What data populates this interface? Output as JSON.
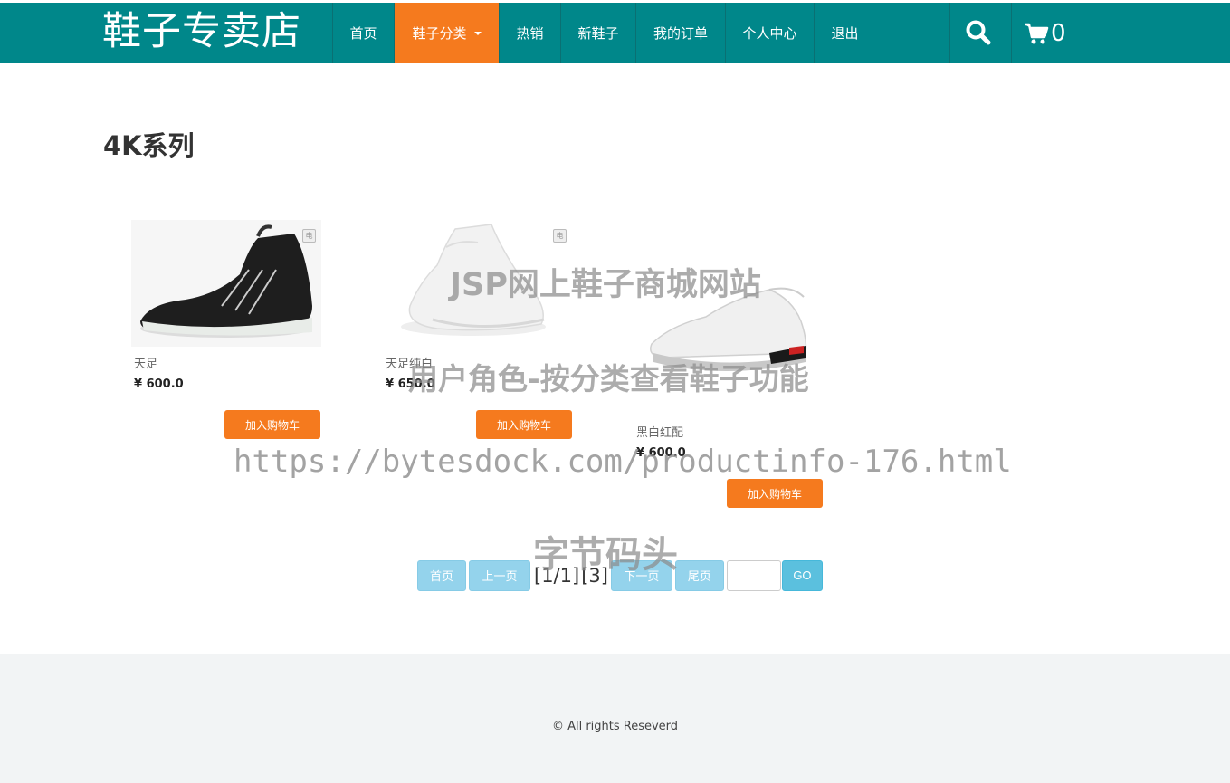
{
  "header": {
    "brand": "鞋子专卖店",
    "nav": [
      {
        "label": "首页",
        "active": false
      },
      {
        "label": "鞋子分类",
        "active": true,
        "dropdown": true
      },
      {
        "label": "热销",
        "active": false
      },
      {
        "label": "新鞋子",
        "active": false
      },
      {
        "label": "我的订单",
        "active": false
      },
      {
        "label": "个人中心",
        "active": false
      },
      {
        "label": "退出",
        "active": false
      }
    ],
    "search_icon": "search-icon",
    "cart_icon": "cart-icon",
    "cart_count": "0"
  },
  "main": {
    "section_title": "4K系列",
    "products": [
      {
        "name": "天足",
        "price": "¥ 600.0",
        "button": "加入购物车",
        "badge": "电"
      },
      {
        "name": "天足纯白",
        "price": "¥ 650.0",
        "button": "加入购物车",
        "badge": "电"
      },
      {
        "name": "黑白红配",
        "price": "¥ 600.0",
        "button": "加入购物车"
      }
    ]
  },
  "pagination": {
    "first": "首页",
    "prev": "上一页",
    "status": "[1/1]",
    "total": "[3]",
    "next": "下一页",
    "last": "尾页",
    "go": "GO",
    "input_value": ""
  },
  "footer": {
    "copyright": "© All rights Reseverd"
  },
  "watermarks": {
    "line1": "JSP网上鞋子商城网站",
    "line2": "用户角色-按分类查看鞋子功能",
    "line3": "https://bytesdock.com/productinfo-176.html",
    "line4": "字节码头"
  },
  "colors": {
    "header_bg": "#00878a",
    "accent_orange": "#f57a1e",
    "pager_light": "#94d3ec",
    "pager_go": "#5bc0de",
    "footer_bg": "#f2f4f5"
  }
}
